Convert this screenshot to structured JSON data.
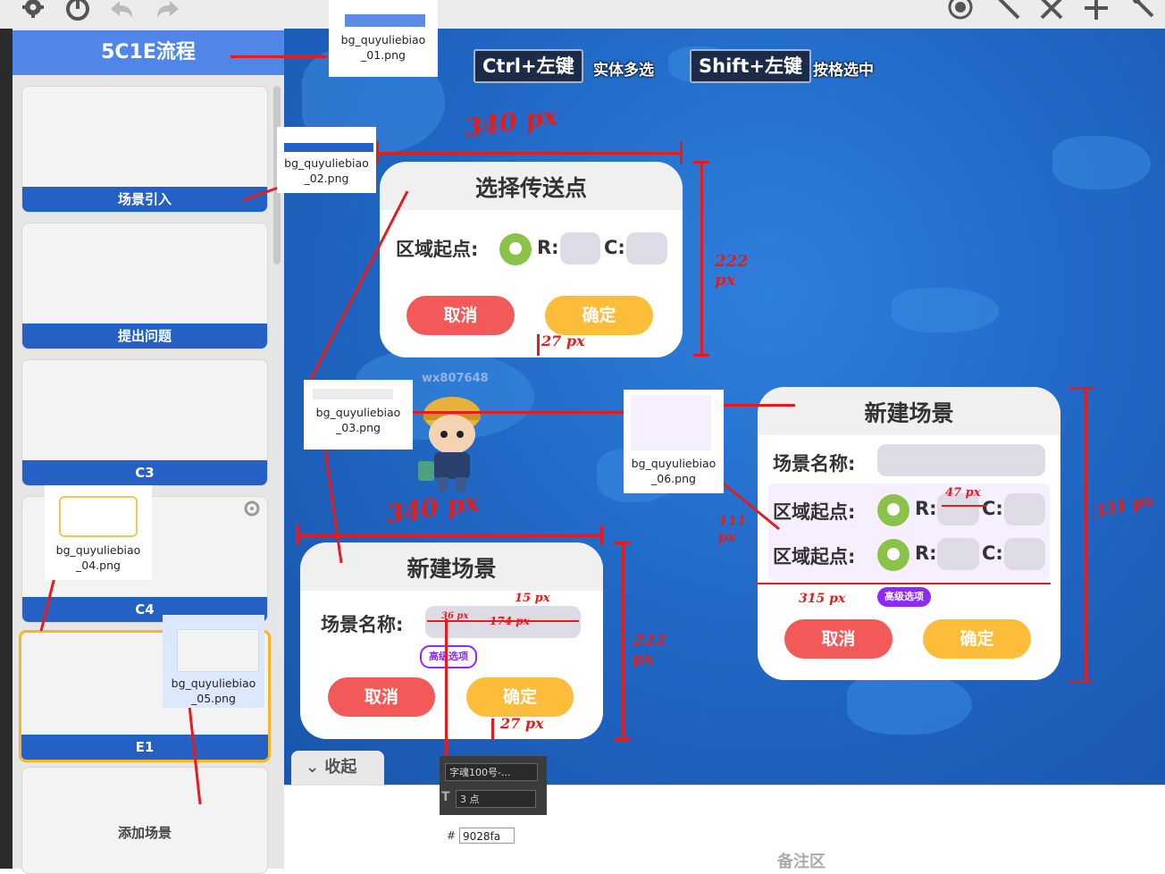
{
  "toolbar": {
    "icons": [
      "gear-icon",
      "power-icon",
      "undo-icon",
      "redo-icon",
      "record-icon",
      "magic-wand-icon",
      "close-icon",
      "plus-icon",
      "pin-icon"
    ]
  },
  "sidebar": {
    "title": "5C1E流程",
    "items": [
      {
        "label": "场景引入"
      },
      {
        "label": "提出问题"
      },
      {
        "label": "C3"
      },
      {
        "label": "C4"
      },
      {
        "label": "E1",
        "active": true
      },
      {
        "label": "添加场景"
      }
    ]
  },
  "canvas": {
    "hint1_key": "Ctrl+左键",
    "hint1_text": "实体多选",
    "hint2_key": "Shift+左键",
    "hint2_text": "按格选中",
    "watermark": "wx807648"
  },
  "dialog_teleport": {
    "title": "选择传送点",
    "region_label": "区域起点:",
    "r_label": "R:",
    "c_label": "C:",
    "cancel": "取消",
    "confirm": "确定"
  },
  "dialog_new_scene_small": {
    "title": "新建场景",
    "name_label": "场景名称:",
    "advanced": "高级选项",
    "cancel": "取消",
    "confirm": "确定"
  },
  "dialog_new_scene_large": {
    "title": "新建场景",
    "name_label": "场景名称:",
    "region_label_1": "区域起点:",
    "region_label_2": "区域起点:",
    "r_label": "R:",
    "c_label": "C:",
    "advanced": "高级选项",
    "cancel": "取消",
    "confirm": "确定"
  },
  "assets": {
    "a01": "bg_quyuliebiao\n_01.png",
    "a02": "bg_quyuliebiao\n_02.png",
    "a03": "bg_quyuliebiao\n_03.png",
    "a04": "bg_quyuliebiao\n_04.png",
    "a05": "bg_quyuliebiao\n_05.png",
    "a06": "bg_quyuliebiao\n_06.png"
  },
  "annotations": {
    "w340_top": "340 px",
    "h222_top": "222 px",
    "gap27_top": "27 px",
    "w340_bottom": "340 px",
    "h222_bottom": "222 px",
    "gap27_bottom": "27 px",
    "h331": "331 px",
    "h111": "111 px",
    "w315": "315 px",
    "w47": "47 px",
    "h15": "15 px",
    "h36": "36 px",
    "w174": "174 px"
  },
  "bottom": {
    "collapse": "收起",
    "font_name": "字魂100号-...",
    "font_size": "3 点",
    "color_hash": "#",
    "color_value": "9028fa",
    "notes_label": "备注区"
  },
  "colors": {
    "accent_blue": "#2560c4",
    "title_blue": "#4f86e8",
    "cancel_red": "#f25a5a",
    "confirm_yellow": "#fbbd3a",
    "advanced_purple": "#9028fa",
    "annotation_red": "#e41c1c"
  }
}
